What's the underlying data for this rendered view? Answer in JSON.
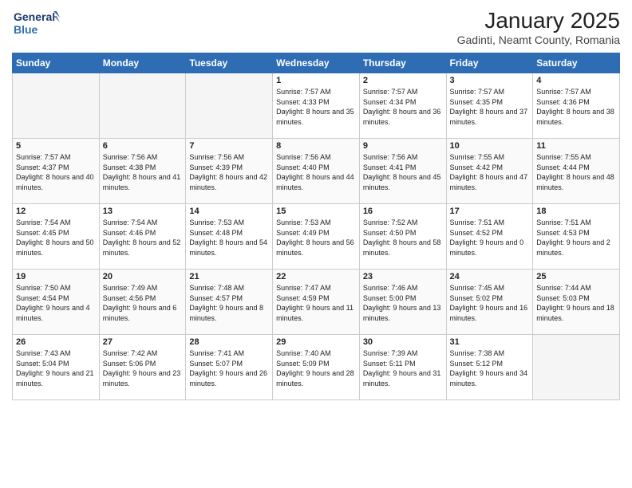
{
  "header": {
    "logo_line1": "General",
    "logo_line2": "Blue",
    "month_title": "January 2025",
    "location": "Gadinti, Neamt County, Romania"
  },
  "days_of_week": [
    "Sunday",
    "Monday",
    "Tuesday",
    "Wednesday",
    "Thursday",
    "Friday",
    "Saturday"
  ],
  "weeks": [
    [
      {
        "day": "",
        "info": ""
      },
      {
        "day": "",
        "info": ""
      },
      {
        "day": "",
        "info": ""
      },
      {
        "day": "1",
        "info": "Sunrise: 7:57 AM\nSunset: 4:33 PM\nDaylight: 8 hours\nand 35 minutes."
      },
      {
        "day": "2",
        "info": "Sunrise: 7:57 AM\nSunset: 4:34 PM\nDaylight: 8 hours\nand 36 minutes."
      },
      {
        "day": "3",
        "info": "Sunrise: 7:57 AM\nSunset: 4:35 PM\nDaylight: 8 hours\nand 37 minutes."
      },
      {
        "day": "4",
        "info": "Sunrise: 7:57 AM\nSunset: 4:36 PM\nDaylight: 8 hours\nand 38 minutes."
      }
    ],
    [
      {
        "day": "5",
        "info": "Sunrise: 7:57 AM\nSunset: 4:37 PM\nDaylight: 8 hours\nand 40 minutes."
      },
      {
        "day": "6",
        "info": "Sunrise: 7:56 AM\nSunset: 4:38 PM\nDaylight: 8 hours\nand 41 minutes."
      },
      {
        "day": "7",
        "info": "Sunrise: 7:56 AM\nSunset: 4:39 PM\nDaylight: 8 hours\nand 42 minutes."
      },
      {
        "day": "8",
        "info": "Sunrise: 7:56 AM\nSunset: 4:40 PM\nDaylight: 8 hours\nand 44 minutes."
      },
      {
        "day": "9",
        "info": "Sunrise: 7:56 AM\nSunset: 4:41 PM\nDaylight: 8 hours\nand 45 minutes."
      },
      {
        "day": "10",
        "info": "Sunrise: 7:55 AM\nSunset: 4:42 PM\nDaylight: 8 hours\nand 47 minutes."
      },
      {
        "day": "11",
        "info": "Sunrise: 7:55 AM\nSunset: 4:44 PM\nDaylight: 8 hours\nand 48 minutes."
      }
    ],
    [
      {
        "day": "12",
        "info": "Sunrise: 7:54 AM\nSunset: 4:45 PM\nDaylight: 8 hours\nand 50 minutes."
      },
      {
        "day": "13",
        "info": "Sunrise: 7:54 AM\nSunset: 4:46 PM\nDaylight: 8 hours\nand 52 minutes."
      },
      {
        "day": "14",
        "info": "Sunrise: 7:53 AM\nSunset: 4:48 PM\nDaylight: 8 hours\nand 54 minutes."
      },
      {
        "day": "15",
        "info": "Sunrise: 7:53 AM\nSunset: 4:49 PM\nDaylight: 8 hours\nand 56 minutes."
      },
      {
        "day": "16",
        "info": "Sunrise: 7:52 AM\nSunset: 4:50 PM\nDaylight: 8 hours\nand 58 minutes."
      },
      {
        "day": "17",
        "info": "Sunrise: 7:51 AM\nSunset: 4:52 PM\nDaylight: 9 hours\nand 0 minutes."
      },
      {
        "day": "18",
        "info": "Sunrise: 7:51 AM\nSunset: 4:53 PM\nDaylight: 9 hours\nand 2 minutes."
      }
    ],
    [
      {
        "day": "19",
        "info": "Sunrise: 7:50 AM\nSunset: 4:54 PM\nDaylight: 9 hours\nand 4 minutes."
      },
      {
        "day": "20",
        "info": "Sunrise: 7:49 AM\nSunset: 4:56 PM\nDaylight: 9 hours\nand 6 minutes."
      },
      {
        "day": "21",
        "info": "Sunrise: 7:48 AM\nSunset: 4:57 PM\nDaylight: 9 hours\nand 8 minutes."
      },
      {
        "day": "22",
        "info": "Sunrise: 7:47 AM\nSunset: 4:59 PM\nDaylight: 9 hours\nand 11 minutes."
      },
      {
        "day": "23",
        "info": "Sunrise: 7:46 AM\nSunset: 5:00 PM\nDaylight: 9 hours\nand 13 minutes."
      },
      {
        "day": "24",
        "info": "Sunrise: 7:45 AM\nSunset: 5:02 PM\nDaylight: 9 hours\nand 16 minutes."
      },
      {
        "day": "25",
        "info": "Sunrise: 7:44 AM\nSunset: 5:03 PM\nDaylight: 9 hours\nand 18 minutes."
      }
    ],
    [
      {
        "day": "26",
        "info": "Sunrise: 7:43 AM\nSunset: 5:04 PM\nDaylight: 9 hours\nand 21 minutes."
      },
      {
        "day": "27",
        "info": "Sunrise: 7:42 AM\nSunset: 5:06 PM\nDaylight: 9 hours\nand 23 minutes."
      },
      {
        "day": "28",
        "info": "Sunrise: 7:41 AM\nSunset: 5:07 PM\nDaylight: 9 hours\nand 26 minutes."
      },
      {
        "day": "29",
        "info": "Sunrise: 7:40 AM\nSunset: 5:09 PM\nDaylight: 9 hours\nand 28 minutes."
      },
      {
        "day": "30",
        "info": "Sunrise: 7:39 AM\nSunset: 5:11 PM\nDaylight: 9 hours\nand 31 minutes."
      },
      {
        "day": "31",
        "info": "Sunrise: 7:38 AM\nSunset: 5:12 PM\nDaylight: 9 hours\nand 34 minutes."
      },
      {
        "day": "",
        "info": ""
      }
    ]
  ]
}
